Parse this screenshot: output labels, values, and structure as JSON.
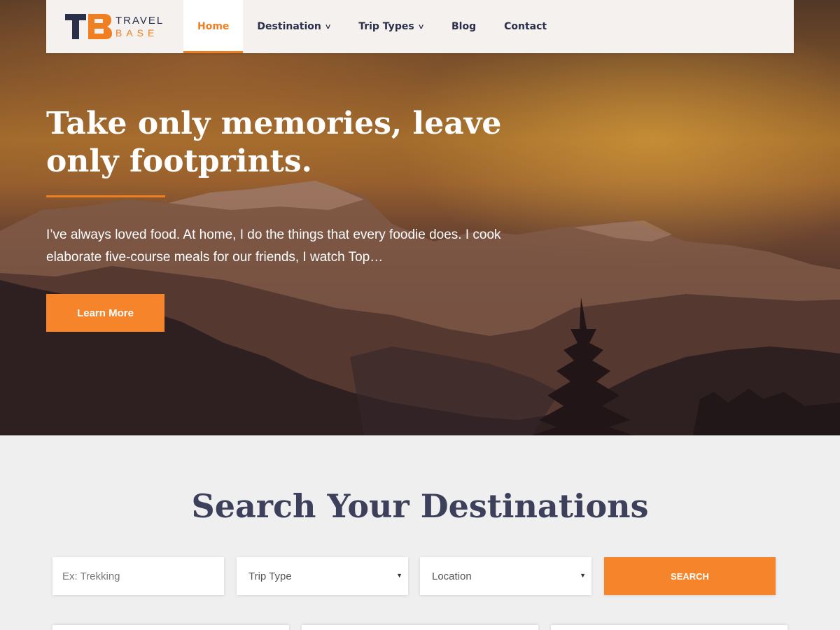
{
  "logo": {
    "line1": "TRAVEL",
    "line2": "BASE",
    "mark": "TB"
  },
  "nav": {
    "items": [
      {
        "label": "Home",
        "active": true,
        "dropdown": false
      },
      {
        "label": "Destination",
        "active": false,
        "dropdown": true
      },
      {
        "label": "Trip Types",
        "active": false,
        "dropdown": true
      },
      {
        "label": "Blog",
        "active": false,
        "dropdown": false
      },
      {
        "label": "Contact",
        "active": false,
        "dropdown": false
      }
    ],
    "dropdown_icon": "chevron-down-icon"
  },
  "hero": {
    "title": "Take only memories, leave only footprints.",
    "description": "I’ve always loved food. At home, I do the things that every foodie does. I cook elaborate five-course meals for our friends, I watch Top…",
    "button_label": "Learn More"
  },
  "search": {
    "title": "Search Your Destinations",
    "keyword_placeholder": "Ex: Trekking",
    "trip_type_selected": "Trip Type",
    "location_selected": "Location",
    "button_label": "SEARCH"
  },
  "colors": {
    "accent": "#f5842b",
    "heading": "#3d405b",
    "nav_text": "#2b2e4a"
  }
}
